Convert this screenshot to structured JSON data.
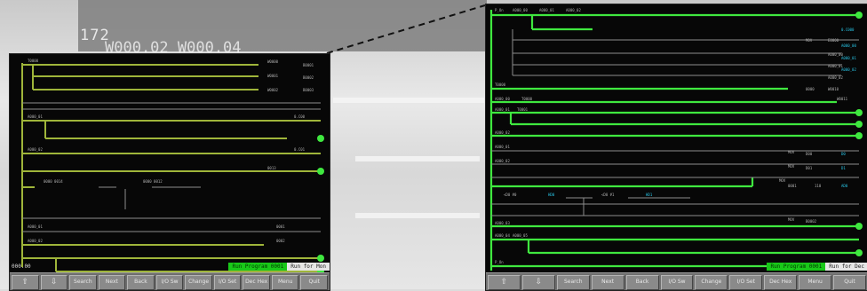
{
  "background": {
    "line_number": "172",
    "register_text": "W000.02 W000.04"
  },
  "colors": {
    "rung": "#3fe83f",
    "rung_dim": "#9fb53a",
    "wire": "#8c8c8c",
    "text": "#b0b0b0",
    "cyan": "#29c5e6",
    "status_green": "#19c819"
  },
  "left_screen": {
    "address": "000.00",
    "status_program": "Run Program 0001",
    "status_mode": "Run for Mon",
    "toolbar": [
      {
        "label": "⇧",
        "icon": "up-arrow-icon"
      },
      {
        "label": "⇩",
        "icon": "down-arrow-icon"
      },
      {
        "label": "Search"
      },
      {
        "label": "Next"
      },
      {
        "label": "Back"
      },
      {
        "label": "I/O Sw"
      },
      {
        "label": "Change"
      },
      {
        "label": "I/O Set"
      },
      {
        "label": "Dec Hex"
      },
      {
        "label": "Menu"
      },
      {
        "label": "Quit"
      }
    ]
  },
  "right_screen": {
    "status_program": "Run Program 0001",
    "status_mode": "Run for Dec",
    "toolbar": [
      {
        "label": "⇧",
        "icon": "up-arrow-icon"
      },
      {
        "label": "⇩",
        "icon": "down-arrow-icon"
      },
      {
        "label": "Search"
      },
      {
        "label": "Next"
      },
      {
        "label": "Back"
      },
      {
        "label": "I/O Sw"
      },
      {
        "label": "Change"
      },
      {
        "label": "I/O Set"
      },
      {
        "label": "Dec Hex"
      },
      {
        "label": "Menu"
      },
      {
        "label": "Quit"
      }
    ]
  }
}
